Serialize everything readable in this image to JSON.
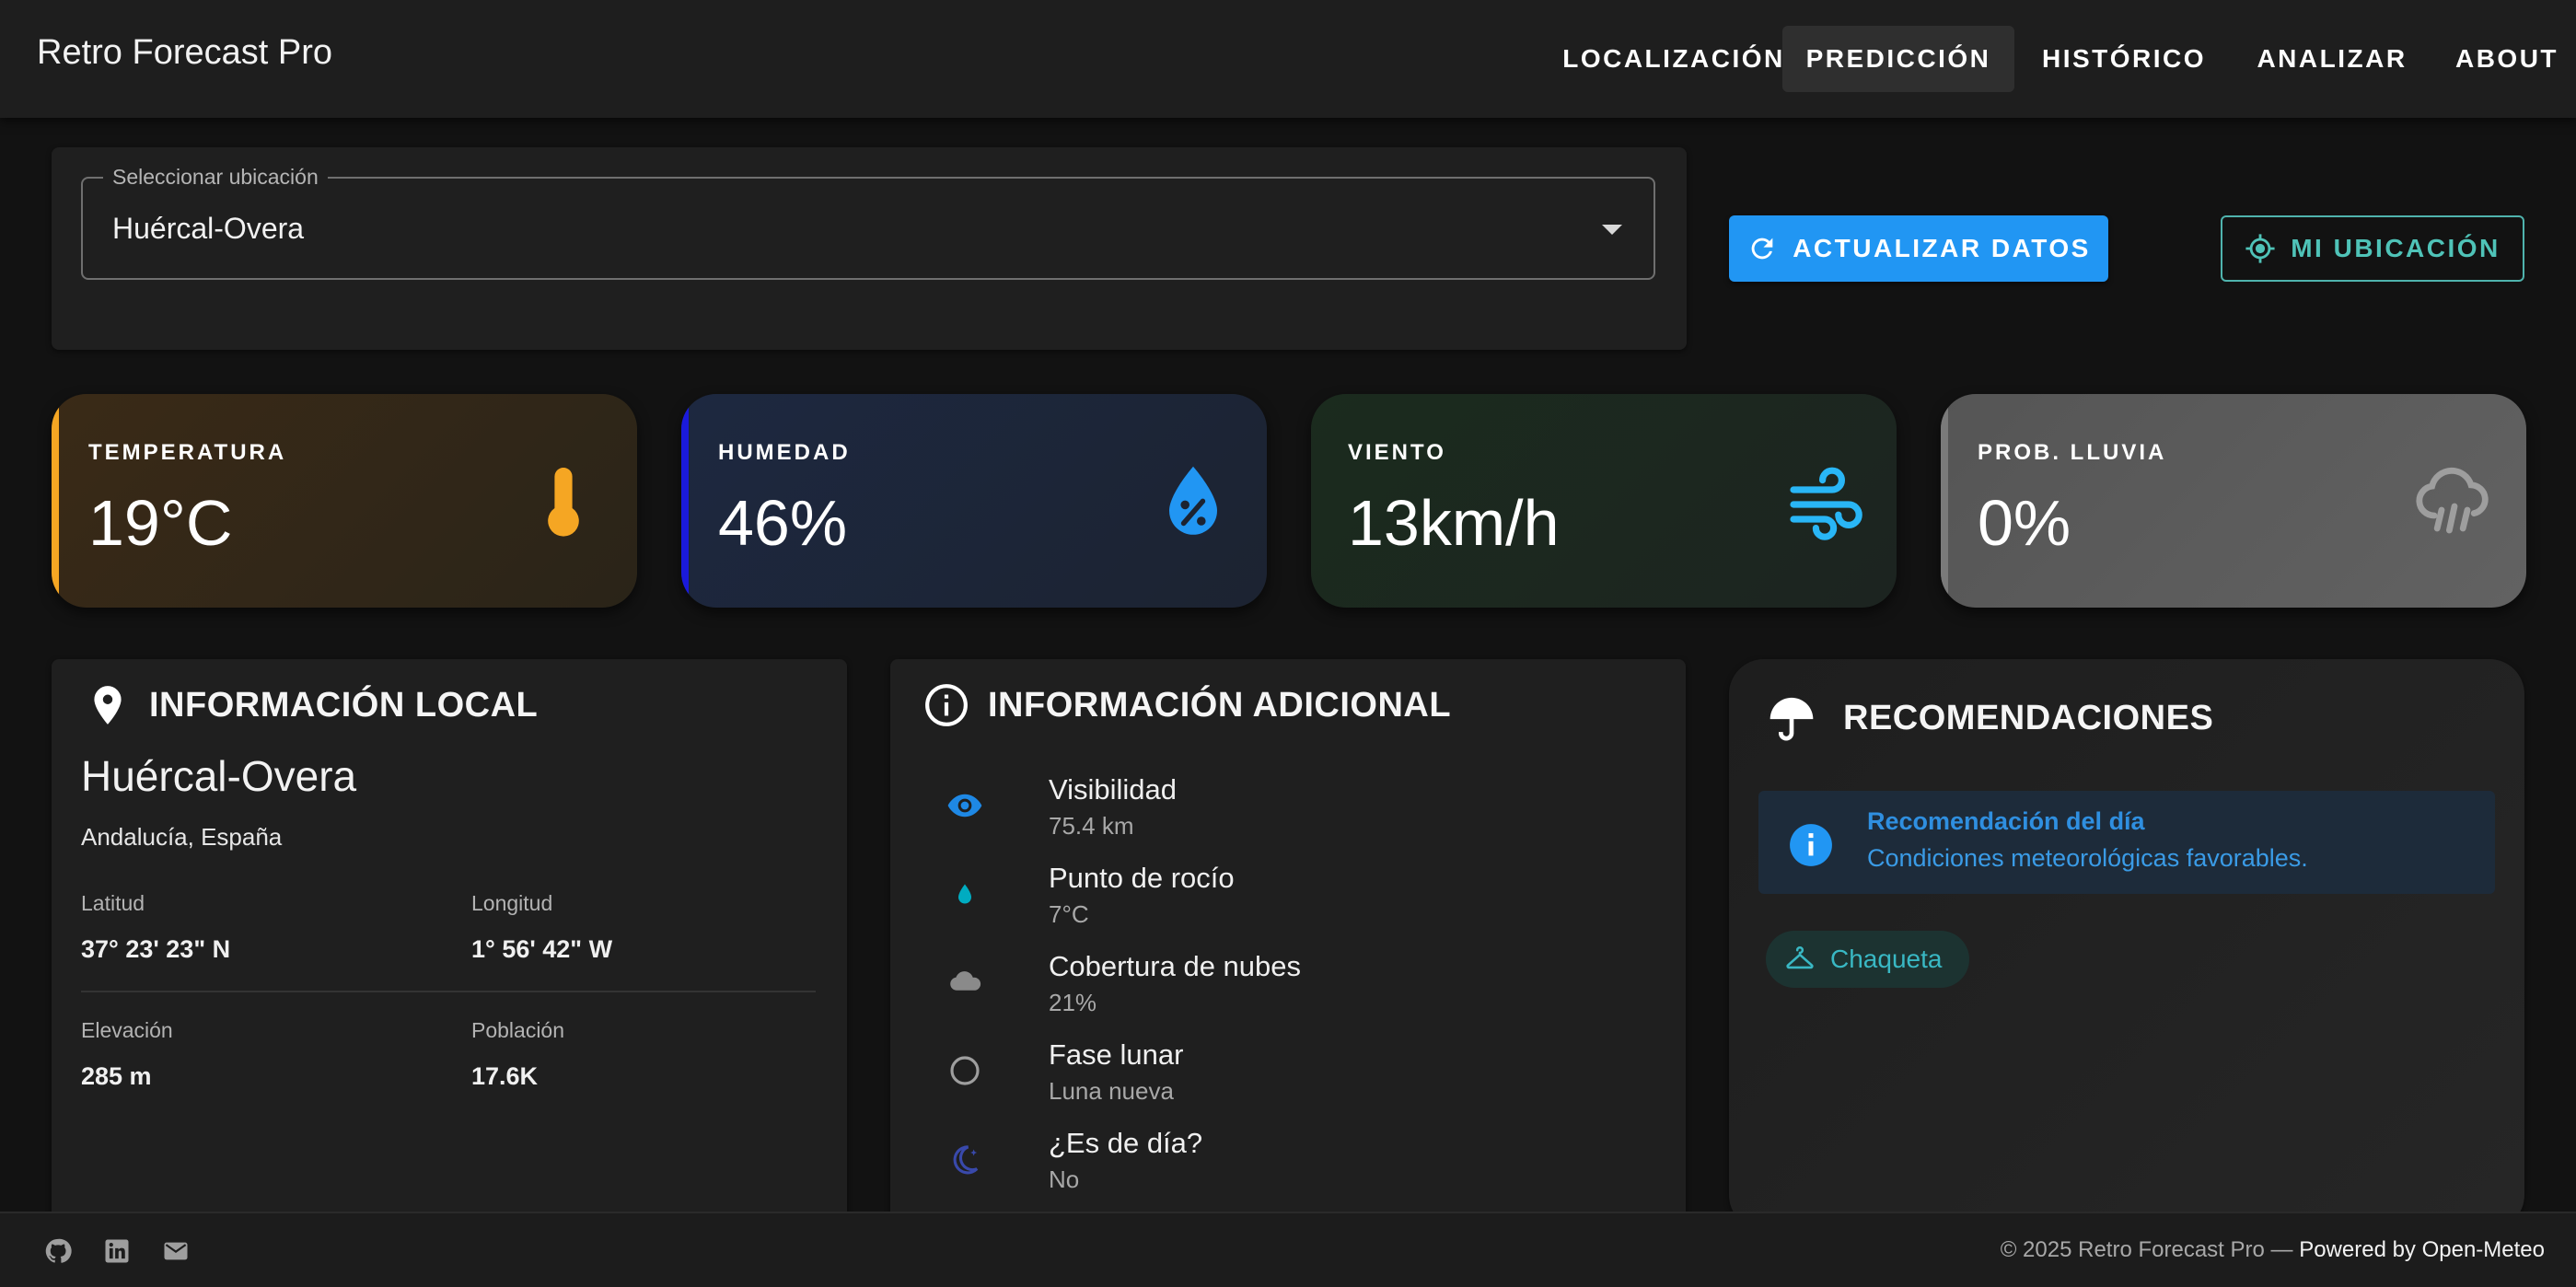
{
  "app": {
    "title": "Retro Forecast Pro"
  },
  "nav": {
    "items": [
      {
        "label": "LOCALIZACIÓN"
      },
      {
        "label": "PREDICCIÓN"
      },
      {
        "label": "HISTÓRICO"
      },
      {
        "label": "ANALIZAR"
      },
      {
        "label": "ABOUT"
      }
    ],
    "active": "PREDICCIÓN"
  },
  "search": {
    "legend": "Seleccionar ubicación",
    "value": "Huércal-Overa",
    "update_label": "ACTUALIZAR DATOS",
    "location_label": "MI UBICACIÓN"
  },
  "stats": {
    "temperature": {
      "label": "TEMPERATURA",
      "value": "19°C",
      "icon": "thermometer-icon",
      "color": "#f5a623"
    },
    "humidity": {
      "label": "HUMEDAD",
      "value": "46%",
      "icon": "humidity-drop-icon",
      "color": "#2196f3"
    },
    "wind": {
      "label": "VIENTO",
      "value": "13km/h",
      "icon": "wind-icon",
      "color": "#29b6f6"
    },
    "rain": {
      "label": "PROB. LLUVIA",
      "value": "0%",
      "icon": "rain-cloud-icon",
      "color": "#9e9e9e"
    }
  },
  "local": {
    "title": "INFORMACIÓN LOCAL",
    "city": "Huércal-Overa",
    "region": "Andalucía, España",
    "latitude_label": "Latitud",
    "latitude": "37° 23' 23\" N",
    "longitude_label": "Longitud",
    "longitude": "1° 56' 42\" W",
    "elevation_label": "Elevación",
    "elevation": "285 m",
    "population_label": "Población",
    "population": "17.6K"
  },
  "extra": {
    "title": "INFORMACIÓN ADICIONAL",
    "items": [
      {
        "label": "Visibilidad",
        "value": "75.4 km",
        "icon": "eye-icon"
      },
      {
        "label": "Punto de rocío",
        "value": "7°C",
        "icon": "dew-drop-icon"
      },
      {
        "label": "Cobertura de nubes",
        "value": "21%",
        "icon": "cloud-icon"
      },
      {
        "label": "Fase lunar",
        "value": "Luna nueva",
        "icon": "moon-phase-icon"
      },
      {
        "label": "¿Es de día?",
        "value": "No",
        "icon": "night-icon"
      }
    ]
  },
  "recommendations": {
    "title": "RECOMENDACIONES",
    "alert_title": "Recomendación del día",
    "alert_text": "Condiciones meteorológicas favorables.",
    "chip": "Chaqueta"
  },
  "footer": {
    "copyright": "© 2025 Retro Forecast Pro —",
    "powered": "Powered by Open-Meteo",
    "icons": [
      "github-icon",
      "linkedin-icon",
      "mail-icon"
    ]
  }
}
